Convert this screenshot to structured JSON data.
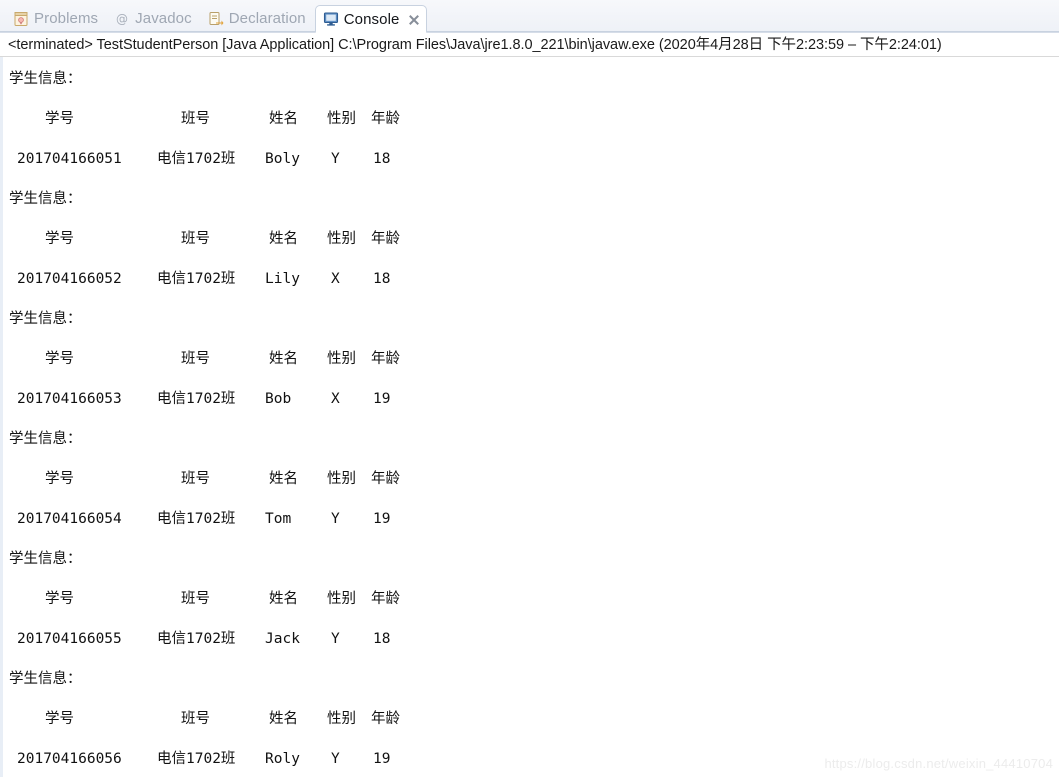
{
  "tabs": [
    {
      "id": "problems",
      "label": "Problems",
      "icon": "problems-icon",
      "active": false
    },
    {
      "id": "javadoc",
      "label": "Javadoc",
      "icon": "javadoc-icon",
      "active": false
    },
    {
      "id": "declaration",
      "label": "Declaration",
      "icon": "declaration-icon",
      "active": false
    },
    {
      "id": "console",
      "label": "Console",
      "icon": "console-icon",
      "active": true
    }
  ],
  "process_line": "<terminated> TestStudentPerson [Java Application] C:\\Program Files\\Java\\jre1.8.0_221\\bin\\javaw.exe  (2020年4月28日 下午2:23:59 – 下午2:24:01)",
  "console": {
    "section_label": "学生信息：",
    "headers": [
      "学号",
      "班号",
      "姓名",
      "性别",
      "年龄"
    ],
    "records": [
      {
        "id": "201704166051",
        "class": "电信1702班",
        "name": "Boly",
        "gender": "Y",
        "age": "18"
      },
      {
        "id": "201704166052",
        "class": "电信1702班",
        "name": "Lily",
        "gender": "X",
        "age": "18"
      },
      {
        "id": "201704166053",
        "class": "电信1702班",
        "name": "Bob",
        "gender": "X",
        "age": "19"
      },
      {
        "id": "201704166054",
        "class": "电信1702班",
        "name": "Tom",
        "gender": "Y",
        "age": "19"
      },
      {
        "id": "201704166055",
        "class": "电信1702班",
        "name": "Jack",
        "gender": "Y",
        "age": "18"
      },
      {
        "id": "201704166056",
        "class": "电信1702班",
        "name": "Roly",
        "gender": "Y",
        "age": "19"
      }
    ],
    "header_line_text": "      学号             班号      姓名  性别  年龄"
  },
  "watermark": "https://blog.csdn.net/weixin_44410704",
  "colors": {
    "tabbar_bg": "#eef1f7",
    "tab_active_bg": "#ffffff",
    "tab_inactive_text": "#9fa7b3",
    "console_text": "#111111",
    "console_bg": "#ffffff",
    "accent_blue": "#3a6ea5"
  }
}
